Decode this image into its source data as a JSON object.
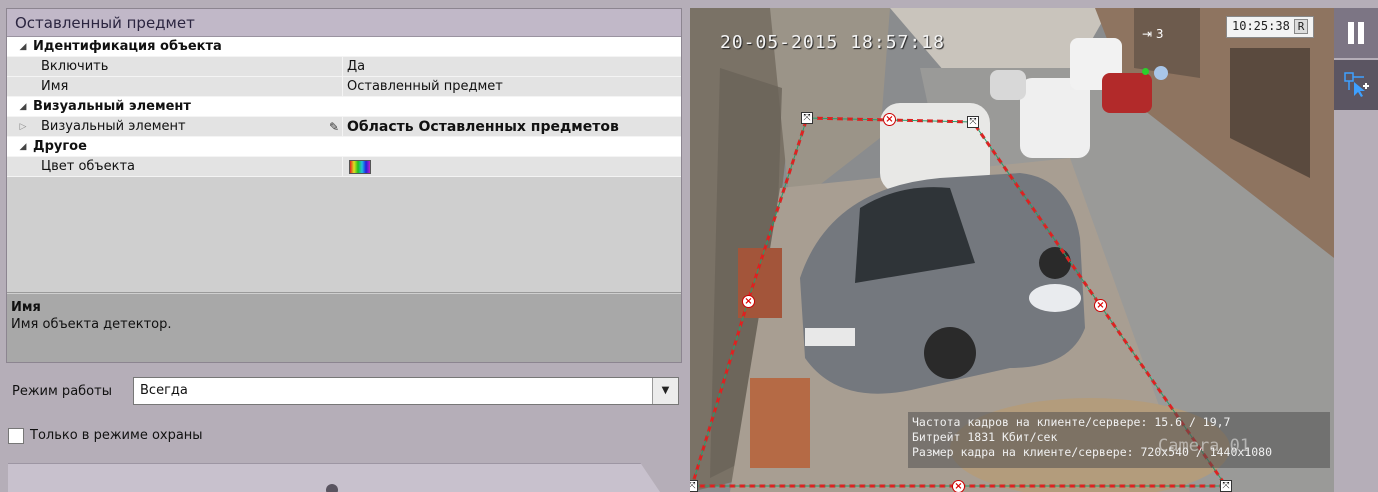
{
  "props": {
    "title": "Оставленный предмет",
    "rows": [
      {
        "kind": "cat",
        "label": "Идентификация объекта"
      },
      {
        "kind": "prop",
        "name": "Включить",
        "value": "Да"
      },
      {
        "kind": "prop",
        "name": "Имя",
        "value": "Оставленный предмет"
      },
      {
        "kind": "cat",
        "label": "Визуальный элемент"
      },
      {
        "kind": "prop",
        "name": "Визуальный элемент",
        "value": "Область Оставленных предметов"
      },
      {
        "kind": "cat",
        "label": "Другое"
      },
      {
        "kind": "prop",
        "name": "Цвет объекта",
        "value": ""
      }
    ],
    "description": {
      "title": "Имя",
      "text": "Имя объекта детектор."
    }
  },
  "mode": {
    "label": "Режим работы",
    "value": "Всегда"
  },
  "guard_only": {
    "label": "Только в режиме охраны",
    "checked": false
  },
  "video": {
    "timestamp": "20-05-2015 18:57:18",
    "clock": "10:25:38",
    "clock_badge": "R",
    "camera_count": "3",
    "stats": {
      "fps": "Частота кадров на клиенте/сервере: 15.6 / 19,7",
      "bitrate": "Битрейт 1831 Кбит/сек",
      "frame_size": "Размер кадра на клиенте/сервере: 720x540 / 1440x1080"
    },
    "camera_name": "Camera 01",
    "zone_color": "#e02020"
  },
  "toolbar": {
    "pause_icon": "pause-icon",
    "zone_icon": "add-zone-icon"
  }
}
